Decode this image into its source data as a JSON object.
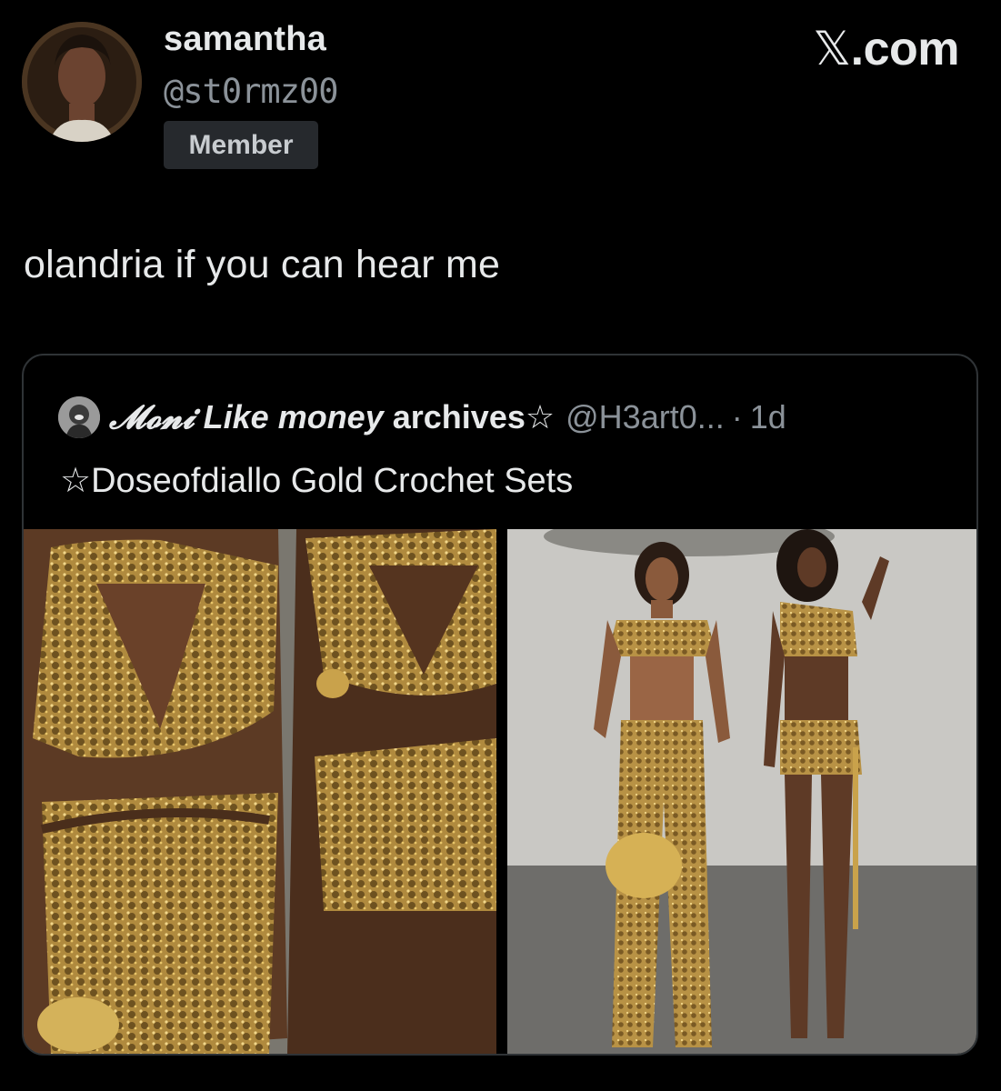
{
  "author": {
    "display_name": "samantha",
    "handle": "@st0rmz00",
    "badge": "Member"
  },
  "site_logo": {
    "glyph": "𝕏",
    "suffix": ".com"
  },
  "tweet": {
    "text": "olandria if you can hear me"
  },
  "quote": {
    "name_part1": "𝓜𝓸𝓷𝓲",
    "name_part2": "Like money",
    "name_part3": "archives☆",
    "handle": "@H3art0...",
    "separator": "·",
    "time": "1d",
    "text": "☆Doseofdiallo Gold Crochet Sets"
  },
  "media": [
    {
      "name": "outfit-photo-closeup"
    },
    {
      "name": "outfit-photo-fullbody"
    }
  ]
}
